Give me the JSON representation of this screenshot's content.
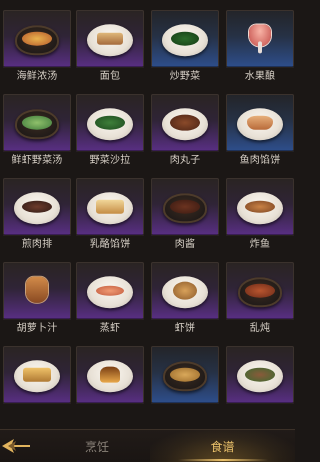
{
  "colors": {
    "label": "#d8d1c7",
    "tab_active": "#e9c06a",
    "tab_inactive": "#8a8279",
    "rarity_purple": "#5a2f86",
    "rarity_blue": "#2e4f8e",
    "rarity_gold": "#8a6426"
  },
  "recipes": [
    {
      "label": "海鲜浓汤",
      "rarity": "purple"
    },
    {
      "label": "面包",
      "rarity": "purple"
    },
    {
      "label": "炒野菜",
      "rarity": "blue"
    },
    {
      "label": "水果酿",
      "rarity": "blue"
    },
    {
      "label": "鲜虾野菜汤",
      "rarity": "purple"
    },
    {
      "label": "野菜沙拉",
      "rarity": "purple"
    },
    {
      "label": "肉丸子",
      "rarity": "purple"
    },
    {
      "label": "鱼肉馅饼",
      "rarity": "blue"
    },
    {
      "label": "煎肉排",
      "rarity": "purple"
    },
    {
      "label": "乳酪馅饼",
      "rarity": "purple"
    },
    {
      "label": "肉酱",
      "rarity": "purple"
    },
    {
      "label": "炸鱼",
      "rarity": "purple"
    },
    {
      "label": "胡萝卜汁",
      "rarity": "purple"
    },
    {
      "label": "蒸虾",
      "rarity": "purple"
    },
    {
      "label": "虾饼",
      "rarity": "purple"
    },
    {
      "label": "乱炖",
      "rarity": "purple"
    },
    {
      "label": "",
      "rarity": "purple"
    },
    {
      "label": "",
      "rarity": "purple"
    },
    {
      "label": "",
      "rarity": "blue"
    },
    {
      "label": "",
      "rarity": "purple"
    }
  ],
  "tabs": {
    "cooking": "烹饪",
    "recipes": "食谱"
  },
  "icons": {
    "back": "back-arrow-icon"
  }
}
